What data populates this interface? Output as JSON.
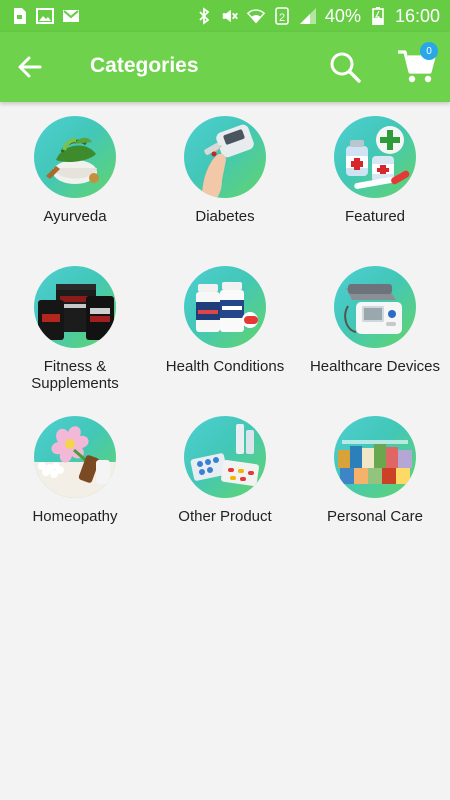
{
  "status_bar": {
    "battery_percent": "40%",
    "time": "16:00",
    "sim_number": "2",
    "icons_left": [
      "sd-card-icon",
      "image-icon",
      "gmail-icon"
    ],
    "icons_right": [
      "bluetooth-icon",
      "mute-icon",
      "wifi-icon",
      "signal-icon",
      "battery-icon"
    ]
  },
  "app_bar": {
    "title": "Categories",
    "cart_count": "0"
  },
  "categories": [
    {
      "label": "Ayurveda",
      "icon": "herbs-bowl"
    },
    {
      "label": "Diabetes",
      "icon": "glucose-meter"
    },
    {
      "label": "Featured",
      "icon": "medicine-bottles"
    },
    {
      "label": "Fitness & Supplements",
      "icon": "protein-tubs"
    },
    {
      "label": "Health Conditions",
      "icon": "supplement-bottles"
    },
    {
      "label": "Healthcare Devices",
      "icon": "bp-monitor"
    },
    {
      "label": "Homeopathy",
      "icon": "flower-pills"
    },
    {
      "label": "Other Product",
      "icon": "pill-blisters"
    },
    {
      "label": "Personal Care",
      "icon": "product-boxes"
    }
  ],
  "colors": {
    "status_bar": "#66cc44",
    "app_bar": "#6fd24c",
    "badge": "#2aa7e8"
  }
}
